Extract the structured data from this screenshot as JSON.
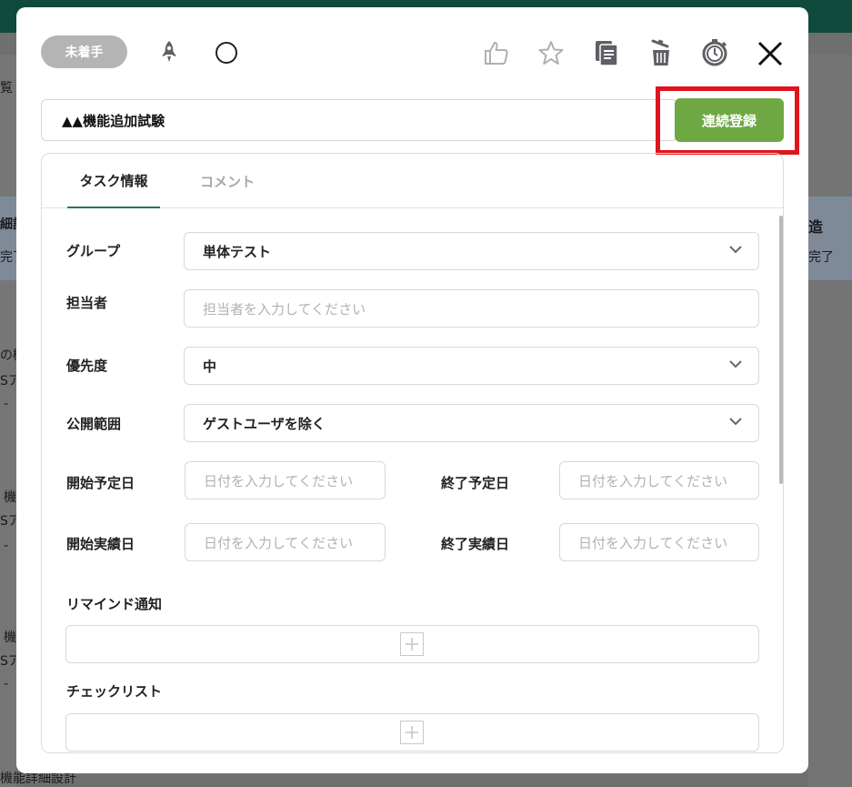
{
  "background": {
    "texts": [
      "覧",
      "細設",
      "完了",
      "の機",
      "Sア",
      "-",
      "機",
      "Sア",
      "-",
      "機",
      "Sア",
      "-",
      "機能詳細設計",
      "造",
      "完了"
    ]
  },
  "header": {
    "status_label": "未着手",
    "icons": [
      "rocket-icon",
      "circle-icon",
      "thumbs-up-icon",
      "star-icon",
      "copy-icon",
      "trash-icon",
      "timer-icon",
      "close-icon"
    ]
  },
  "task": {
    "title": "▲▲機能追加試験",
    "continuous_register_label": "連続登録"
  },
  "tabs": {
    "task_info": "タスク情報",
    "comment": "コメント"
  },
  "form": {
    "group_label": "グループ",
    "group_value": "単体テスト",
    "assignee_label": "担当者",
    "assignee_placeholder": "担当者を入力してください",
    "priority_label": "優先度",
    "priority_value": "中",
    "visibility_label": "公開範囲",
    "visibility_value": "ゲストユーザを除く",
    "planned_start_label": "開始予定日",
    "planned_start_placeholder": "日付を入力してください",
    "planned_end_label": "終了予定日",
    "planned_end_placeholder": "日付を入力してください",
    "actual_start_label": "開始実績日",
    "actual_start_placeholder": "日付を入力してください",
    "actual_end_label": "終了実績日",
    "actual_end_placeholder": "日付を入力してください",
    "reminder_label": "リマインド通知",
    "checklist_label": "チェックリスト"
  },
  "colors": {
    "accent_green": "#6ea843",
    "tab_underline": "#1f7a5a",
    "highlight_red": "#e0141c",
    "status_pill": "#b4b4b4"
  }
}
